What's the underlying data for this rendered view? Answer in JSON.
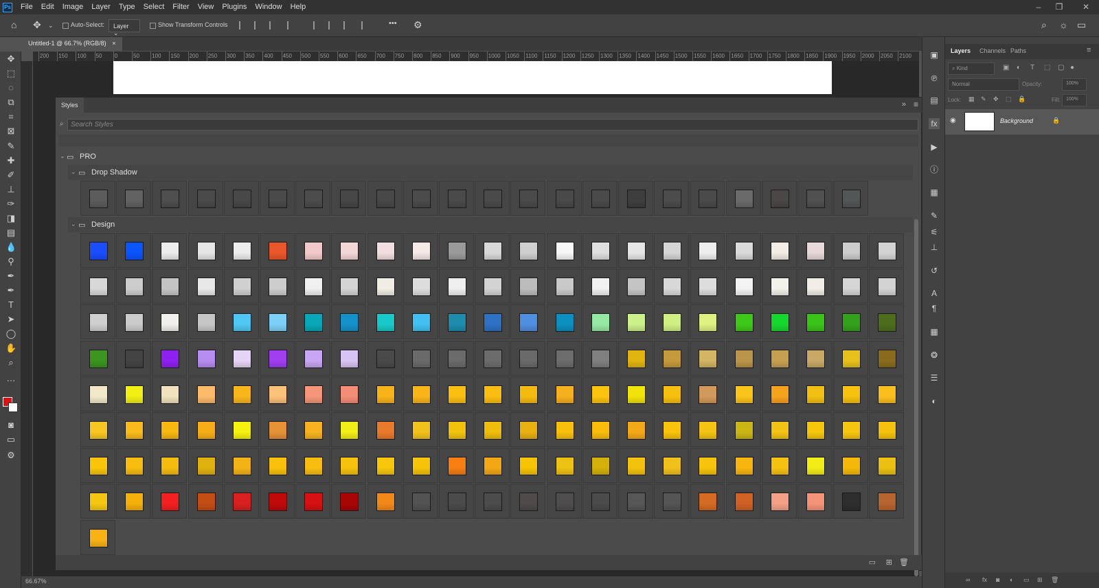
{
  "app": {
    "logo": "Ps",
    "menu": [
      "File",
      "Edit",
      "Image",
      "Layer",
      "Type",
      "Select",
      "Filter",
      "View",
      "Plugins",
      "Window",
      "Help"
    ]
  },
  "options": {
    "auto_select_label": "Auto-Select:",
    "layer_select": "Layer",
    "transform_label": "Show Transform Controls",
    "more": "•••"
  },
  "document": {
    "tab_title": "Untitled-1 @ 66.7% (RGB/8)",
    "close": "×"
  },
  "ruler": {
    "labels": [
      "200",
      "150",
      "100",
      "50",
      "0",
      "50",
      "100",
      "150",
      "200",
      "250",
      "300",
      "350",
      "400",
      "450",
      "500",
      "550",
      "600",
      "650",
      "700",
      "750",
      "800",
      "850",
      "900",
      "950",
      "1000",
      "1050",
      "1100",
      "1150",
      "1200",
      "1250",
      "1300",
      "1350",
      "1400",
      "1450",
      "1500",
      "1550",
      "1600",
      "1650",
      "1700",
      "1750",
      "1800",
      "1850",
      "1900",
      "1950",
      "2000",
      "2050",
      "2100"
    ]
  },
  "styles_panel": {
    "tab": "Styles",
    "search_placeholder": "Search Styles",
    "group_pro": "PRO",
    "group_drop_shadow": "Drop Shadow",
    "group_design": "Design",
    "menu_icon": "≡",
    "collapse_icon": "»"
  },
  "swatches": {
    "drop_shadow": [
      "#5c5c5c",
      "#626262",
      "#4e4e4e",
      "#4a4a4a",
      "#484848",
      "#4a4a4a",
      "#4c4c4c",
      "#474747",
      "#484848",
      "#4b4b4b",
      "#4a4a4a",
      "#4a4a4a",
      "#4a4a4a",
      "#494949",
      "#4a4a4a",
      "#3e3e3e",
      "#4c4c4c",
      "#4a4a4a",
      "#6a6a6a",
      "#4b4747",
      "#505050",
      "#525656"
    ],
    "design_rows": [
      [
        "#1a4dff",
        "#0b55ff",
        "#ececec",
        "#e6e6e6",
        "#ececec",
        "#e9582a",
        "#f2c9c9",
        "#f3d7d7",
        "#f2dede",
        "#f6e9e6",
        "#9a9a9a",
        "#d8d8d8",
        "#cfcfcf",
        "#f7f7f7",
        "#dedede",
        "#e5e5e5",
        "#d5d5d5",
        "#eeeeee",
        "#dadada",
        "#f1ede6",
        "#e8d8d8",
        "#cccccc",
        "#d3d3d3"
      ],
      [
        "#d8d8d8",
        "#cccccc",
        "#c4c4c4",
        "#e8e8e8",
        "#d0d0d0",
        "#cdcdcd",
        "#f0f0f0",
        "#d4d4d4",
        "#f0ede4",
        "#dddddd",
        "#efefef",
        "#d3d3d3",
        "#bcbcbc",
        "#c9c9c9",
        "#f1f1f1",
        "#c4c4c4",
        "#d8d8d8",
        "#dddddd",
        "#f4f4f4",
        "#f3f1ec",
        "#f0eee6",
        "#d5d5d5",
        "#d3d3d3"
      ],
      [
        "#cfcfcf",
        "#cbcbcb",
        "#f1efe9",
        "#c6c6c6",
        "#4fc7f2",
        "#7ccff7",
        "#0aa7b8",
        "#1591c9",
        "#19c8c8",
        "#41c1f2",
        "#1d8cad",
        "#2d72c4",
        "#4f8ee0",
        "#0c90c0",
        "#97e8a4",
        "#ccf08a",
        "#cfef83",
        "#def080",
        "#3ec81a",
        "#16d72e",
        "#3ac419",
        "#34a11d",
        "#4d6d1c"
      ],
      [
        "#3b9520",
        "#444444",
        "#8e20f2",
        "#b68df0",
        "#e5d4f6",
        "#a03ef0",
        "#c9a6f3",
        "#d8c4f4",
        "#4a4a4a",
        "#6a6a6a",
        "#6b6b6b",
        "#6c6c6c",
        "#6a6a6a",
        "#6d6d6d",
        "#808080",
        "#e2b40f",
        "#c59a3d",
        "#d4b566",
        "#b99449",
        "#c5a050",
        "#c9a866",
        "#e8c01c",
        "#8a6b1e"
      ],
      [
        "#f1e8c8",
        "#f2ef14",
        "#efe2bc",
        "#fbbb6a",
        "#f8b61b",
        "#fcc27a",
        "#f49679",
        "#f48d76",
        "#f8b318",
        "#f9b418",
        "#fbbf11",
        "#fbbe10",
        "#f5ba10",
        "#f6b01d",
        "#fbc40f",
        "#f0e30a",
        "#f8c00e",
        "#d29a5a",
        "#fbc418",
        "#f7a21d",
        "#f2c012",
        "#f7c10d",
        "#fbbf1d"
      ],
      [
        "#f8c622",
        "#f9bb1c",
        "#f8b812",
        "#f5ae17",
        "#f6f20f",
        "#e69237",
        "#f6b31f",
        "#f2ee18",
        "#e9792b",
        "#f2c11b",
        "#f2c20d",
        "#f0bd0c",
        "#e9b011",
        "#f7c00d",
        "#f8bd0b",
        "#f2a918",
        "#f7c30c",
        "#f4c313",
        "#cbb514",
        "#f2c314",
        "#f5c60b",
        "#f6c50f",
        "#f4c20c"
      ],
      [
        "#f8c50a",
        "#f7bc0f",
        "#f4bc0f",
        "#e0b210",
        "#f3b216",
        "#f9c10b",
        "#f7be11",
        "#f6c20e",
        "#f6c70b",
        "#f5c30a",
        "#f77f12",
        "#f3a714",
        "#f6c305",
        "#eec213",
        "#d3b10a",
        "#f3c20c",
        "#f1c01c",
        "#f6c40c",
        "#f8b50e",
        "#f6c210",
        "#f2ed16",
        "#f6b808",
        "#ebc011"
      ],
      [
        "#f4c612",
        "#f4b008",
        "#f22020",
        "#c24d15",
        "#d82020",
        "#c00a0a",
        "#d51111",
        "#a80606",
        "#f28818",
        "#535353",
        "#4b4b4b",
        "#4c4c4c",
        "#4f4b4b",
        "#4f4d4d",
        "#4b4b4b",
        "#575757",
        "#555555",
        "#d46a24",
        "#cf6125",
        "#f4a087",
        "#f39478",
        "#2e2e2e",
        "#b8642f"
      ],
      [
        "#f8b215"
      ]
    ]
  },
  "status": {
    "zoom": "66.67%"
  },
  "layers_panel": {
    "tabs": [
      "Layers",
      "Channels",
      "Paths"
    ],
    "kind_label": "Kind",
    "blend_mode": "Normal",
    "opacity_label": "Opacity:",
    "opacity_value": "100%",
    "lock_label": "Lock:",
    "fill_label": "Fill:",
    "fill_value": "100%",
    "layer_name": "Background"
  },
  "colors": {
    "foreground": "#e01010",
    "background": "#ffffff"
  }
}
